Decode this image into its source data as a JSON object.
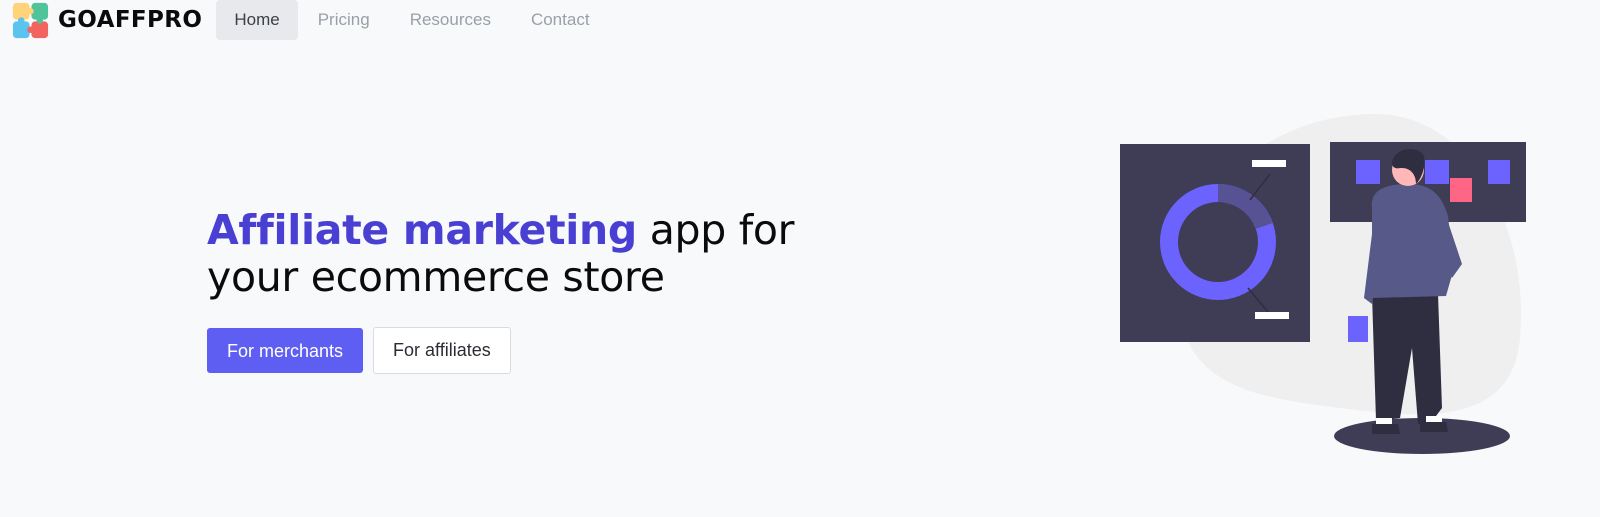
{
  "brand": {
    "name": "GOAFFPRO"
  },
  "nav": {
    "items": [
      {
        "label": "Home",
        "active": true
      },
      {
        "label": "Pricing",
        "active": false
      },
      {
        "label": "Resources",
        "active": false
      },
      {
        "label": "Contact",
        "active": false
      }
    ]
  },
  "hero": {
    "headline_accent": "Affiliate marketing",
    "headline_line1_rest": " app for",
    "headline_line2": "your ecommerce store",
    "primary_cta": "For merchants",
    "secondary_cta": "For affiliates"
  },
  "colors": {
    "accent": "#4a3fd3",
    "button_primary": "#5e5ef2",
    "illustration_dark": "#3f3d56",
    "illustration_purple": "#6c63ff",
    "illustration_pink": "#ff6584"
  }
}
